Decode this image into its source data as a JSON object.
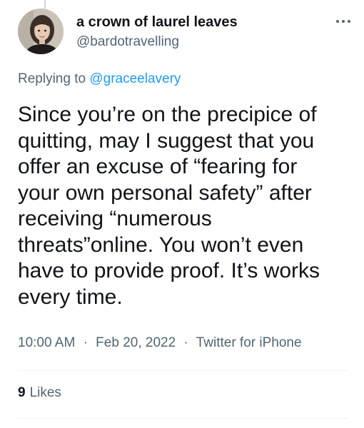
{
  "user": {
    "display_name": "a crown of laurel leaves",
    "handle": "@bardotravelling"
  },
  "reply": {
    "prefix": "Replying to ",
    "to_handle": "@graceelavery"
  },
  "tweet": {
    "text": "Since you’re on the precipice of\nquitting, may I suggest that you\noffer an excuse of “fearing for\nyour own personal safety” after\nreceiving “numerous\nthreats”online.  You won’t even\nhave to provide proof.  It’s works\nevery time."
  },
  "meta": {
    "time": "10:00 AM",
    "separator": "·",
    "date": "Feb 20, 2022",
    "source": "Twitter for iPhone"
  },
  "stats": {
    "likes_count": "9",
    "likes_label": "Likes"
  },
  "icons": {
    "more": "more-horizontal-icon"
  },
  "colors": {
    "text": "#0f1419",
    "secondary": "#536471",
    "link": "#1d9bf0",
    "divider": "#eff3f4"
  }
}
